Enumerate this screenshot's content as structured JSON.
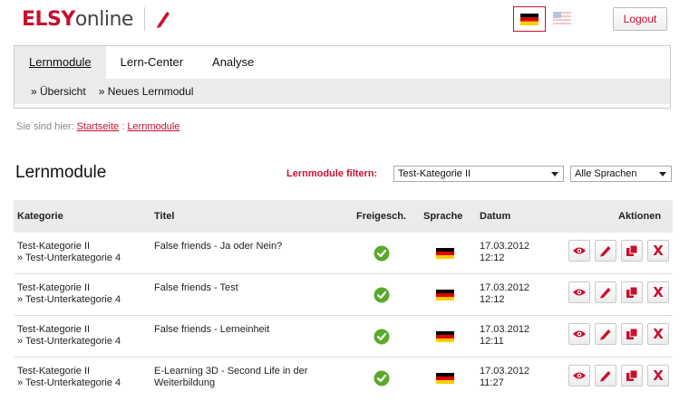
{
  "logo": {
    "brand": "ELSY",
    "suffix": "online"
  },
  "header": {
    "logout_label": "Logout"
  },
  "nav": {
    "tabs": [
      {
        "label": "Lernmodule"
      },
      {
        "label": "Lern-Center"
      },
      {
        "label": "Analyse"
      }
    ],
    "sub": [
      {
        "label": "» Übersicht"
      },
      {
        "label": "» Neues Lernmodul"
      }
    ]
  },
  "breadcrumb": {
    "prefix": "Sie sind hier:",
    "home": "Startseite",
    "sep": ":",
    "current": "Lernmodule"
  },
  "page": {
    "title": "Lernmodule"
  },
  "filter": {
    "label": "Lernmodule filtern:",
    "category_value": "Test-Kategorie II",
    "language_value": "Alle Sprachen"
  },
  "table": {
    "headers": {
      "kategorie": "Kategorie",
      "titel": "Titel",
      "freigeschaltet": "Freigesch.",
      "sprache": "Sprache",
      "datum": "Datum",
      "aktionen": "Aktionen"
    },
    "rows": [
      {
        "category": "Test-Kategorie II",
        "subcategory": "» Test-Unterkategorie 4",
        "title": "False friends - Ja oder Nein?",
        "date": "17.03.2012",
        "time": "12:12"
      },
      {
        "category": "Test-Kategorie II",
        "subcategory": "» Test-Unterkategorie 4",
        "title": "False friends - Test",
        "date": "17.03.2012",
        "time": "12:12"
      },
      {
        "category": "Test-Kategorie II",
        "subcategory": "» Test-Unterkategorie 4",
        "title": "False friends - Lerneinheit",
        "date": "17.03.2012",
        "time": "12:11"
      },
      {
        "category": "Test-Kategorie II",
        "subcategory": "» Test-Unterkategorie 4",
        "title": "E-Learning 3D - Second Life in der Weiterbildung",
        "date": "17.03.2012",
        "time": "11:27"
      }
    ],
    "action_delete_label": "X"
  },
  "colors": {
    "brand_red": "#c8102e",
    "nav_gray": "#ebebeb",
    "check_green": "#5aaa2a"
  }
}
